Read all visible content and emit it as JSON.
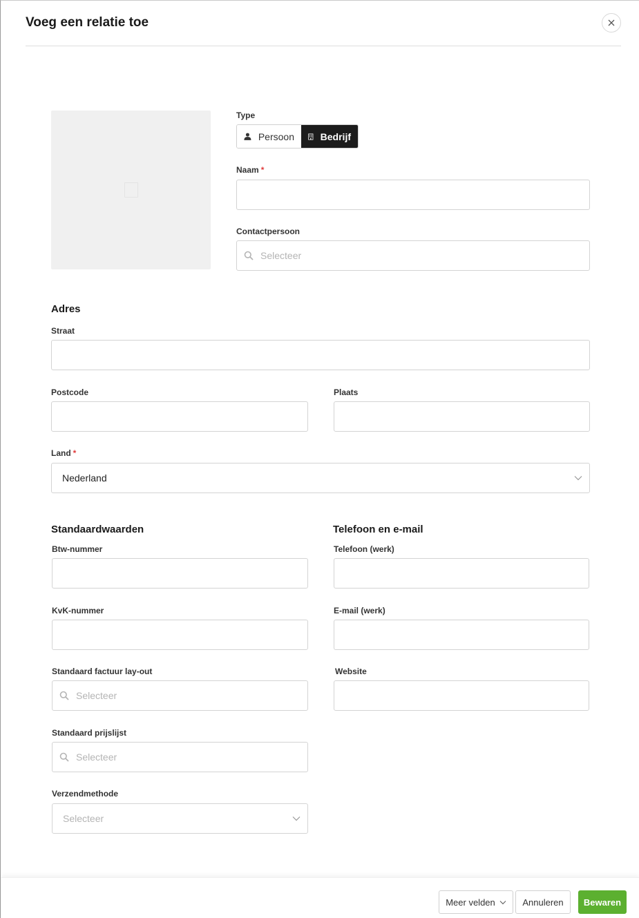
{
  "modal": {
    "title": "Voeg een relatie toe",
    "close_icon": "close-icon"
  },
  "photo": {
    "icon": "image-placeholder-icon"
  },
  "type": {
    "label": "Type",
    "options": [
      {
        "label": "Persoon",
        "icon": "person-icon",
        "selected": false
      },
      {
        "label": "Bedrijf",
        "icon": "building-icon",
        "selected": true
      }
    ]
  },
  "naam": {
    "label": "Naam",
    "required": "*",
    "value": ""
  },
  "contactpersoon": {
    "label": "Contactpersoon",
    "placeholder": "Selecteer"
  },
  "adres": {
    "title": "Adres",
    "straat": {
      "label": "Straat",
      "value": ""
    },
    "postcode": {
      "label": "Postcode",
      "value": ""
    },
    "plaats": {
      "label": "Plaats",
      "value": ""
    },
    "land": {
      "label": "Land",
      "required": "*",
      "value": "Nederland"
    }
  },
  "standaardwaarden": {
    "title": "Standaardwaarden",
    "btw": {
      "label": "Btw-nummer",
      "value": ""
    },
    "kvk": {
      "label": "KvK-nummer",
      "value": ""
    },
    "factuur_layout": {
      "label": "Standaard factuur lay-out",
      "placeholder": "Selecteer"
    },
    "prijslijst": {
      "label": "Standaard prijslijst",
      "placeholder": "Selecteer"
    },
    "verzendmethode": {
      "label": "Verzendmethode",
      "placeholder": "Selecteer"
    }
  },
  "telefoon_email": {
    "title": "Telefoon en e-mail",
    "telefoon": {
      "label": "Telefoon (werk)",
      "value": ""
    },
    "email": {
      "label": "E-mail (werk)",
      "value": ""
    },
    "website": {
      "label": "Website",
      "value": ""
    }
  },
  "footer": {
    "more_fields": "Meer velden",
    "cancel": "Annuleren",
    "save": "Bewaren"
  },
  "colors": {
    "primary": "#5cb030",
    "required": "#e03c3c",
    "toggle_active": "#1c1c1c"
  }
}
